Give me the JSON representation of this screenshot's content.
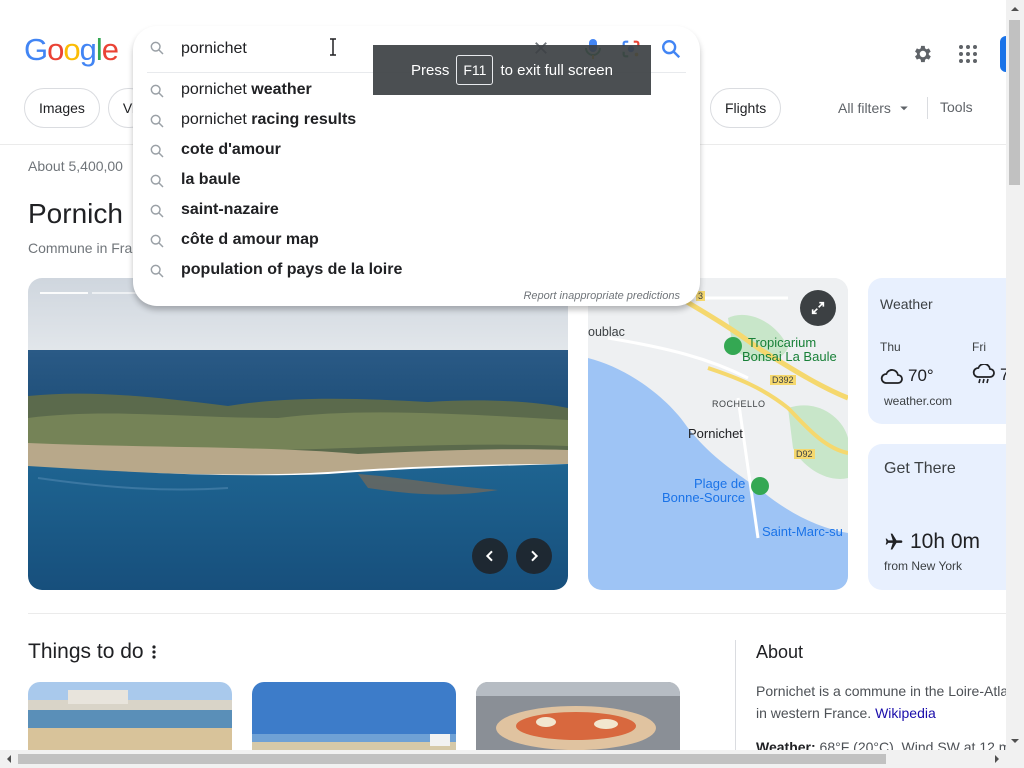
{
  "logo": {
    "letters": [
      "G",
      "o",
      "o",
      "g",
      "l",
      "e"
    ],
    "colors": [
      "#4285F4",
      "#EA4335",
      "#FBBC05",
      "#4285F4",
      "#34A853",
      "#EA4335"
    ]
  },
  "search": {
    "query": "pornichet"
  },
  "suggestions": [
    {
      "plain": "pornichet ",
      "bold": "weather"
    },
    {
      "plain": "pornichet ",
      "bold": "racing results"
    },
    {
      "plain": "",
      "bold": "cote d'amour"
    },
    {
      "plain": "",
      "bold": "la baule"
    },
    {
      "plain": "",
      "bold": "saint-nazaire"
    },
    {
      "plain": "",
      "bold": "côte d amour map"
    },
    {
      "plain": "",
      "bold": "population of pays de la loire"
    }
  ],
  "report_text": "Report inappropriate predictions",
  "toast": {
    "press": "Press",
    "key": "F11",
    "rest": "to exit full screen"
  },
  "chips": [
    "Images",
    "Vi"
  ],
  "chip_flights": "Flights",
  "all_filters": "All filters",
  "tools": "Tools",
  "result_count": "About 5,400,00",
  "entity": {
    "title": "Pornich",
    "subtitle": "Commune in Fra"
  },
  "map": {
    "labels": {
      "oublac": "oublac",
      "tropicarium1": "Tropicarium",
      "tropicarium2": "Bonsai La Baule",
      "rochello": "ROCHELLO",
      "pornichet": "Pornichet",
      "plage1": "Plage de",
      "plage2": "Bonne-Source",
      "saintmarc": "Saint-Marc-su",
      "d392": "D392",
      "d92": "D92",
      "r3": "3"
    }
  },
  "weather": {
    "title": "Weather",
    "days": [
      {
        "day": "Thu",
        "temp": "70°"
      },
      {
        "day": "Fri",
        "temp": "7"
      }
    ],
    "source": "weather.com"
  },
  "get_there": {
    "title": "Get There",
    "duration": "10h 0m",
    "from": "from New York"
  },
  "things_to_do": "Things to do",
  "about": {
    "title": "About",
    "line1": "Pornichet is a commune in the Loire-Atla",
    "line2_prefix": "in western France. ",
    "line2_link": "Wikipedia",
    "weather_label": "Weather:",
    "weather_value": " 68°F (20°C), Wind SW at 12 m"
  }
}
